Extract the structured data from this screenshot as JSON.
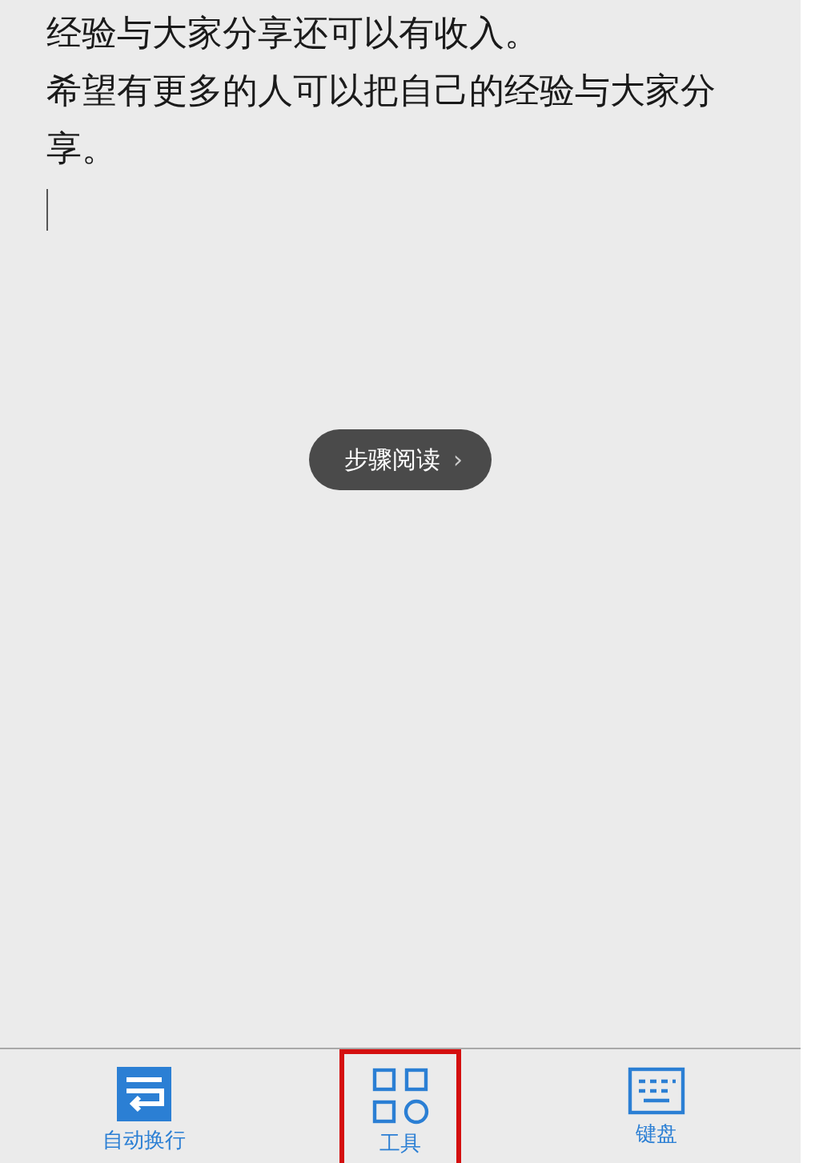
{
  "editor": {
    "paragraphs": [
      "经验与大家分享还可以有收入。",
      "希望有更多的人可以把自己的经验与大家分享。"
    ]
  },
  "step_reading_button": {
    "label": "步骤阅读",
    "chevron": "›"
  },
  "toolbar": {
    "items": [
      {
        "kind": "wrap",
        "label": "自动换行",
        "highlighted": false
      },
      {
        "kind": "tools",
        "label": "工具",
        "highlighted": true
      },
      {
        "kind": "keyboard",
        "label": "键盘",
        "highlighted": false
      }
    ]
  }
}
